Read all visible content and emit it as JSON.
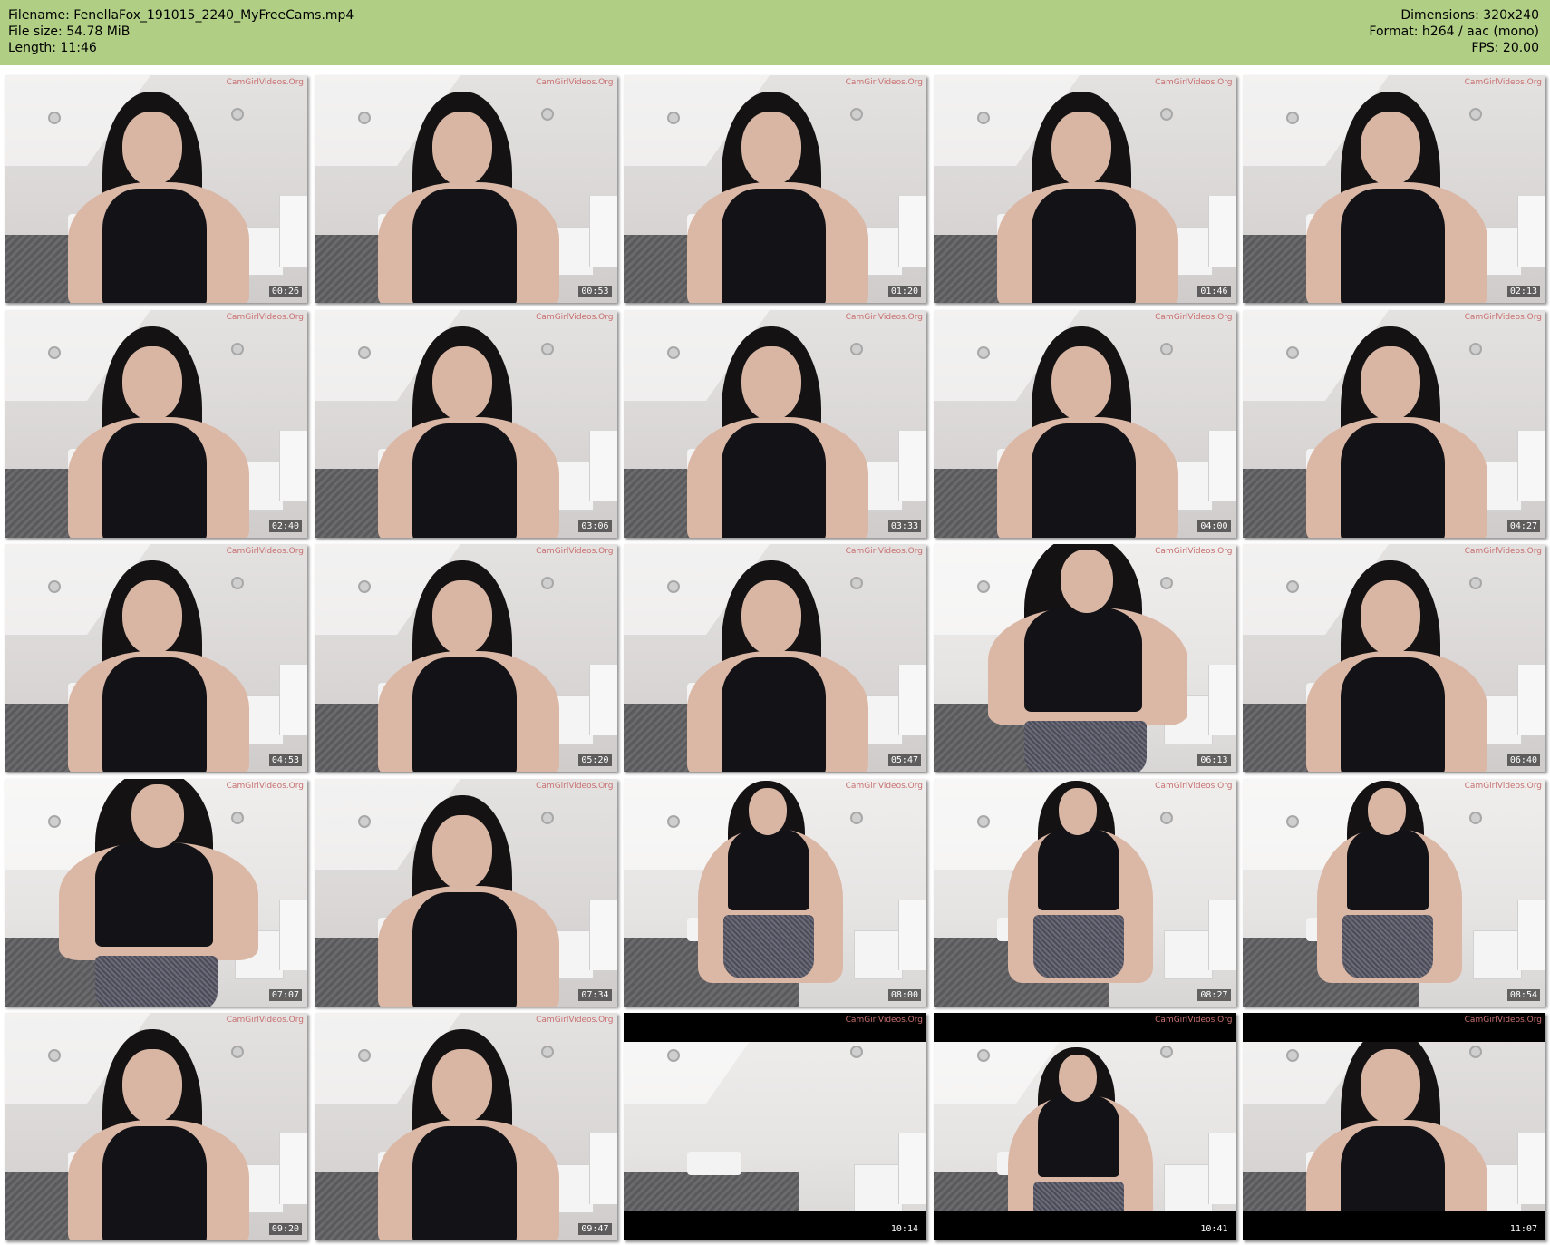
{
  "header": {
    "filename_label": "Filename: FenellaFox_191015_2240_MyFreeCams.mp4",
    "filesize_label": "File size: 54.78 MiB",
    "length_label": "Length: 11:46",
    "dimensions_label": "Dimensions: 320x240",
    "format_label": "Format: h264 / aac (mono)",
    "fps_label": "FPS: 20.00"
  },
  "watermark": "CamGirlVideos.Org",
  "thumbnails": [
    {
      "time": "00:26",
      "scene": "seated"
    },
    {
      "time": "00:53",
      "scene": "seated"
    },
    {
      "time": "01:20",
      "scene": "seated"
    },
    {
      "time": "01:46",
      "scene": "seated"
    },
    {
      "time": "02:13",
      "scene": "seated"
    },
    {
      "time": "02:40",
      "scene": "seated"
    },
    {
      "time": "03:06",
      "scene": "seated"
    },
    {
      "time": "03:33",
      "scene": "seated"
    },
    {
      "time": "04:00",
      "scene": "seated"
    },
    {
      "time": "04:27",
      "scene": "seated"
    },
    {
      "time": "04:53",
      "scene": "seated"
    },
    {
      "time": "05:20",
      "scene": "seated"
    },
    {
      "time": "05:47",
      "scene": "seated"
    },
    {
      "time": "06:13",
      "scene": "standing-close"
    },
    {
      "time": "06:40",
      "scene": "seated"
    },
    {
      "time": "07:07",
      "scene": "standing-close"
    },
    {
      "time": "07:34",
      "scene": "seated"
    },
    {
      "time": "08:00",
      "scene": "standing-far"
    },
    {
      "time": "08:27",
      "scene": "standing-far"
    },
    {
      "time": "08:54",
      "scene": "standing-far"
    },
    {
      "time": "09:20",
      "scene": "seated"
    },
    {
      "time": "09:47",
      "scene": "seated"
    },
    {
      "time": "10:14",
      "scene": "empty-room"
    },
    {
      "time": "10:41",
      "scene": "standing-far-letterbox"
    },
    {
      "time": "11:07",
      "scene": "seated-letterbox"
    }
  ]
}
